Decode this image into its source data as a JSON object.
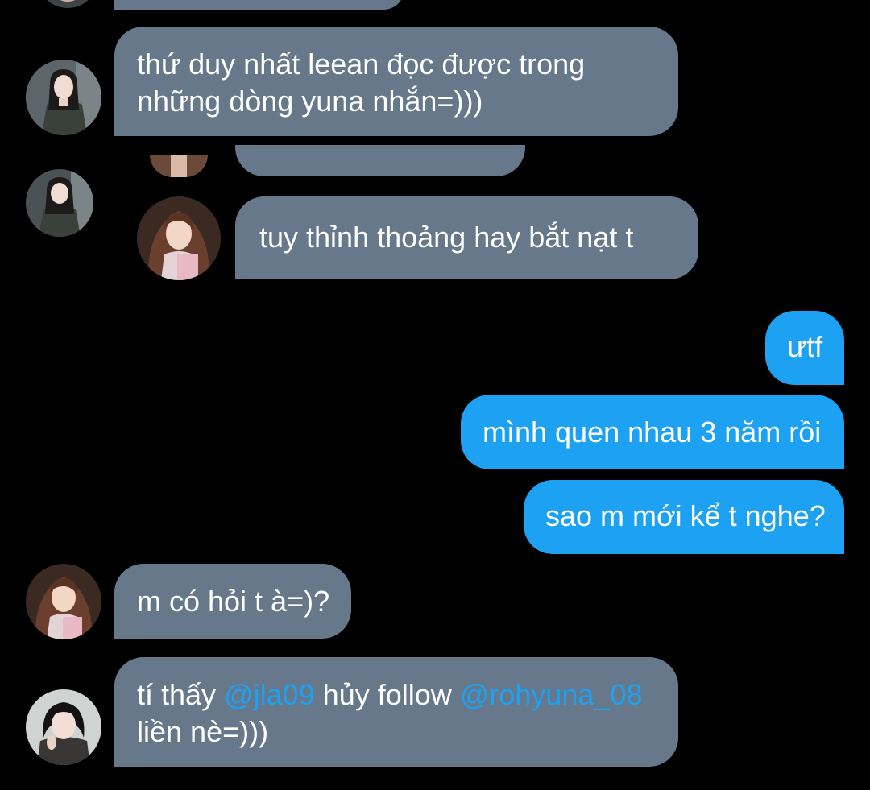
{
  "conversation": {
    "messages": [
      {
        "id": "m0",
        "direction": "incoming",
        "lines": [
          ""
        ]
      },
      {
        "id": "m1",
        "direction": "incoming",
        "lines": [
          "thứ duy nhất leean đọc được trong",
          "những dòng yuna nhắn=)))"
        ]
      },
      {
        "id": "m2",
        "direction": "incoming",
        "lines": [
          ""
        ]
      },
      {
        "id": "m3",
        "direction": "incoming",
        "lines": [
          "tuy thỉnh thoảng hay bắt nạt t"
        ]
      },
      {
        "id": "m4",
        "direction": "outgoing",
        "lines": [
          "ưtf"
        ]
      },
      {
        "id": "m5",
        "direction": "outgoing",
        "lines": [
          "mình quen nhau 3 năm rồi"
        ]
      },
      {
        "id": "m6",
        "direction": "outgoing",
        "lines": [
          "sao m mới kể t nghe?"
        ]
      },
      {
        "id": "m7",
        "direction": "incoming",
        "lines": [
          "m có hỏi t à=)?"
        ]
      },
      {
        "id": "m8",
        "direction": "incoming",
        "line1": {
          "prefix": "tí thấy ",
          "mention1": "@jla09",
          "middle": " hủy follow ",
          "mention2": "@rohyuna_08"
        },
        "line2": "liền nè=)))"
      }
    ]
  },
  "colors": {
    "background": "#000000",
    "incoming_bubble": "#66788a",
    "outgoing_bubble": "#1da1f2",
    "mention": "#1da1f2",
    "text": "#ffffff"
  },
  "icons": {
    "avatar_1": "user-avatar-photo",
    "avatar_2": "user-avatar-photo",
    "avatar_3": "user-avatar-photo",
    "avatar_4": "user-avatar-photo",
    "avatar_5": "user-avatar-photo"
  }
}
